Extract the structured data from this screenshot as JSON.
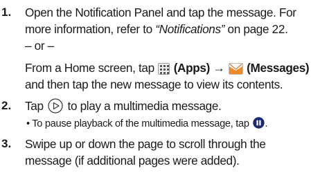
{
  "steps": [
    {
      "number": "1.",
      "line1": "Open the Notification Panel and tap the message. For",
      "line2_a": "more information, refer to ",
      "line2_ref": "“Notifications”",
      "line2_b": " on page 22.",
      "or": "– or –",
      "alt_a": "From a Home screen, tap ",
      "alt_apps": "(Apps)",
      "alt_arrow": " → ",
      "alt_messages": "(Messages)",
      "alt_line2": "and then tap the new message to view its contents."
    },
    {
      "number": "2.",
      "text_a": "Tap ",
      "text_b": " to play a multimedia message.",
      "bullet": "• To pause playback of the multimedia message, tap ",
      "bullet_end": "."
    },
    {
      "number": "3.",
      "line1": "Swipe up or down the page to scroll through the",
      "line2": "message (if additional pages were added)."
    }
  ],
  "icons": {
    "apps": "apps-grid-icon",
    "messages": "messages-envelope-icon",
    "play": "play-circle-icon",
    "pause": "pause-circle-icon"
  },
  "colors": {
    "text": "#1a1a1a",
    "messages_icon": "#f08a24",
    "pause_icon": "#1a2a6c"
  }
}
